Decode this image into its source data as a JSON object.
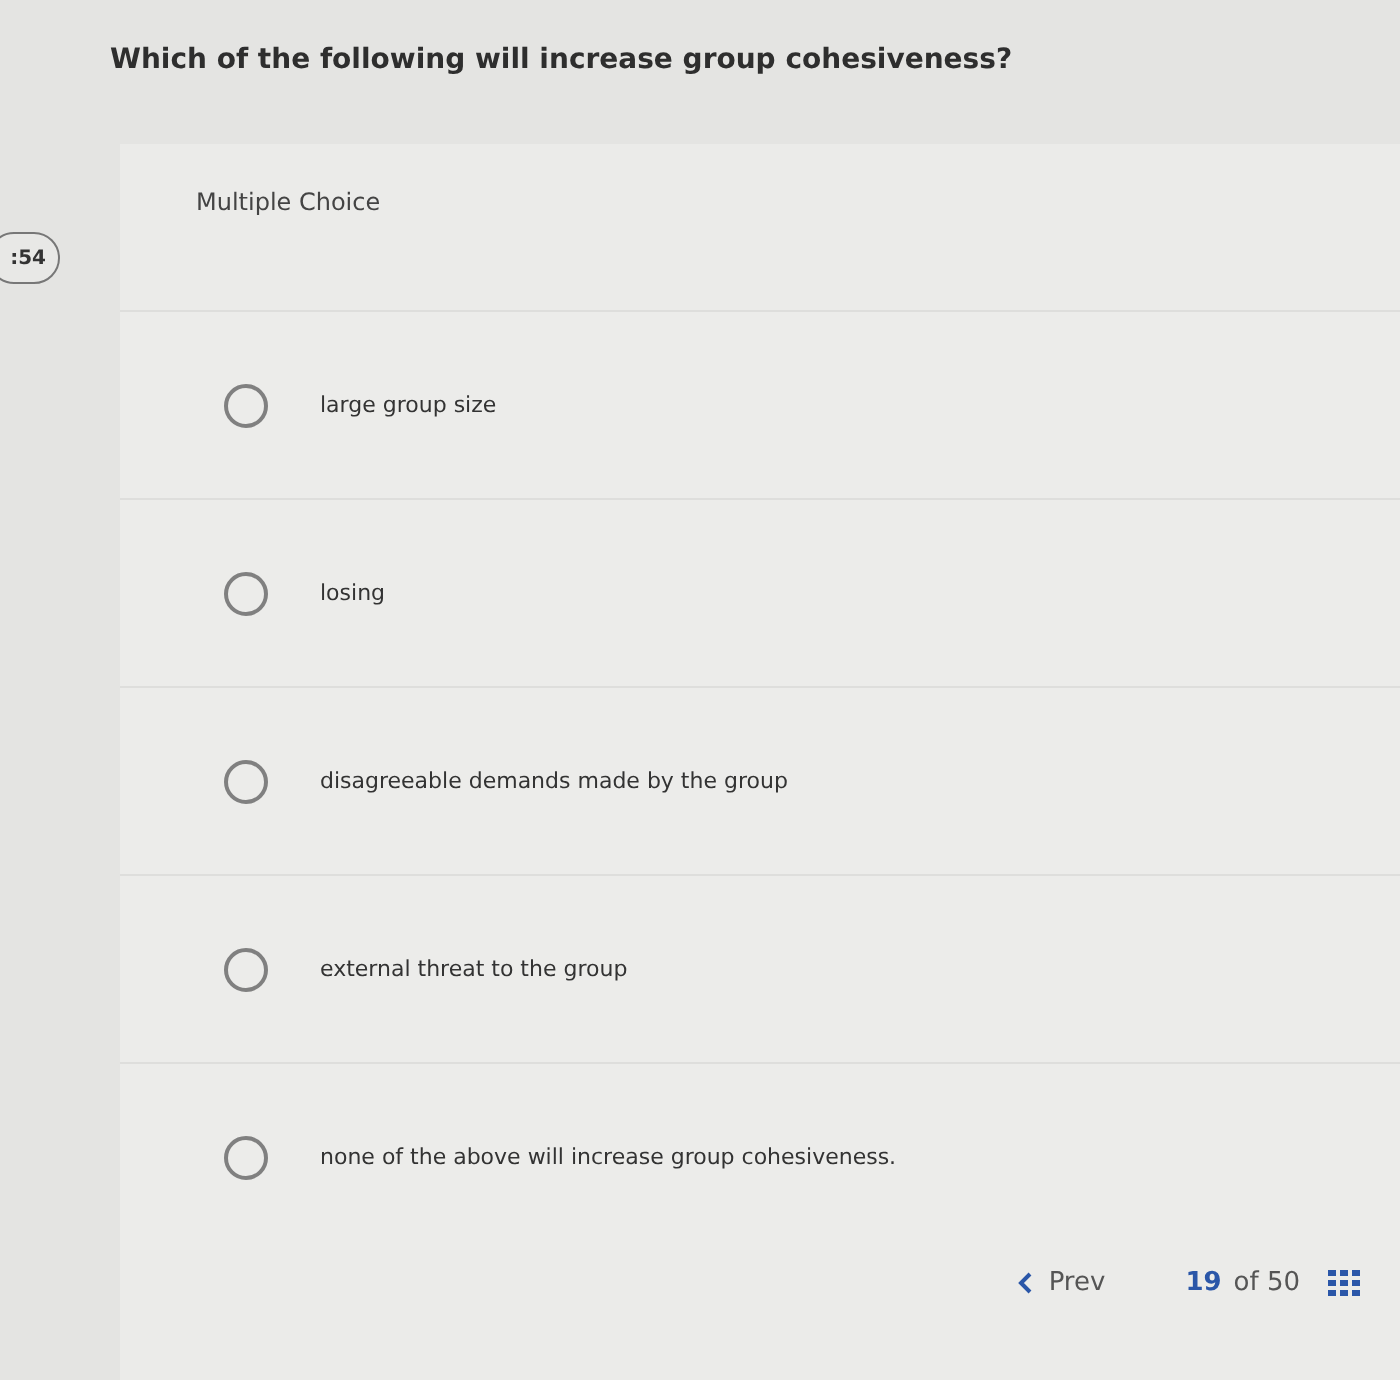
{
  "question": "Which of the following will increase group cohesiveness?",
  "timer": ":54",
  "type_label": "Multiple Choice",
  "options": [
    {
      "label": "large group size",
      "selected": false
    },
    {
      "label": "losing",
      "selected": false
    },
    {
      "label": "disagreeable demands made by the group",
      "selected": false
    },
    {
      "label": "external threat to the group",
      "selected": false
    },
    {
      "label": "none of the above will increase group cohesiveness.",
      "selected": false
    }
  ],
  "nav": {
    "prev": "Prev",
    "current": "19",
    "of": "of 50"
  }
}
